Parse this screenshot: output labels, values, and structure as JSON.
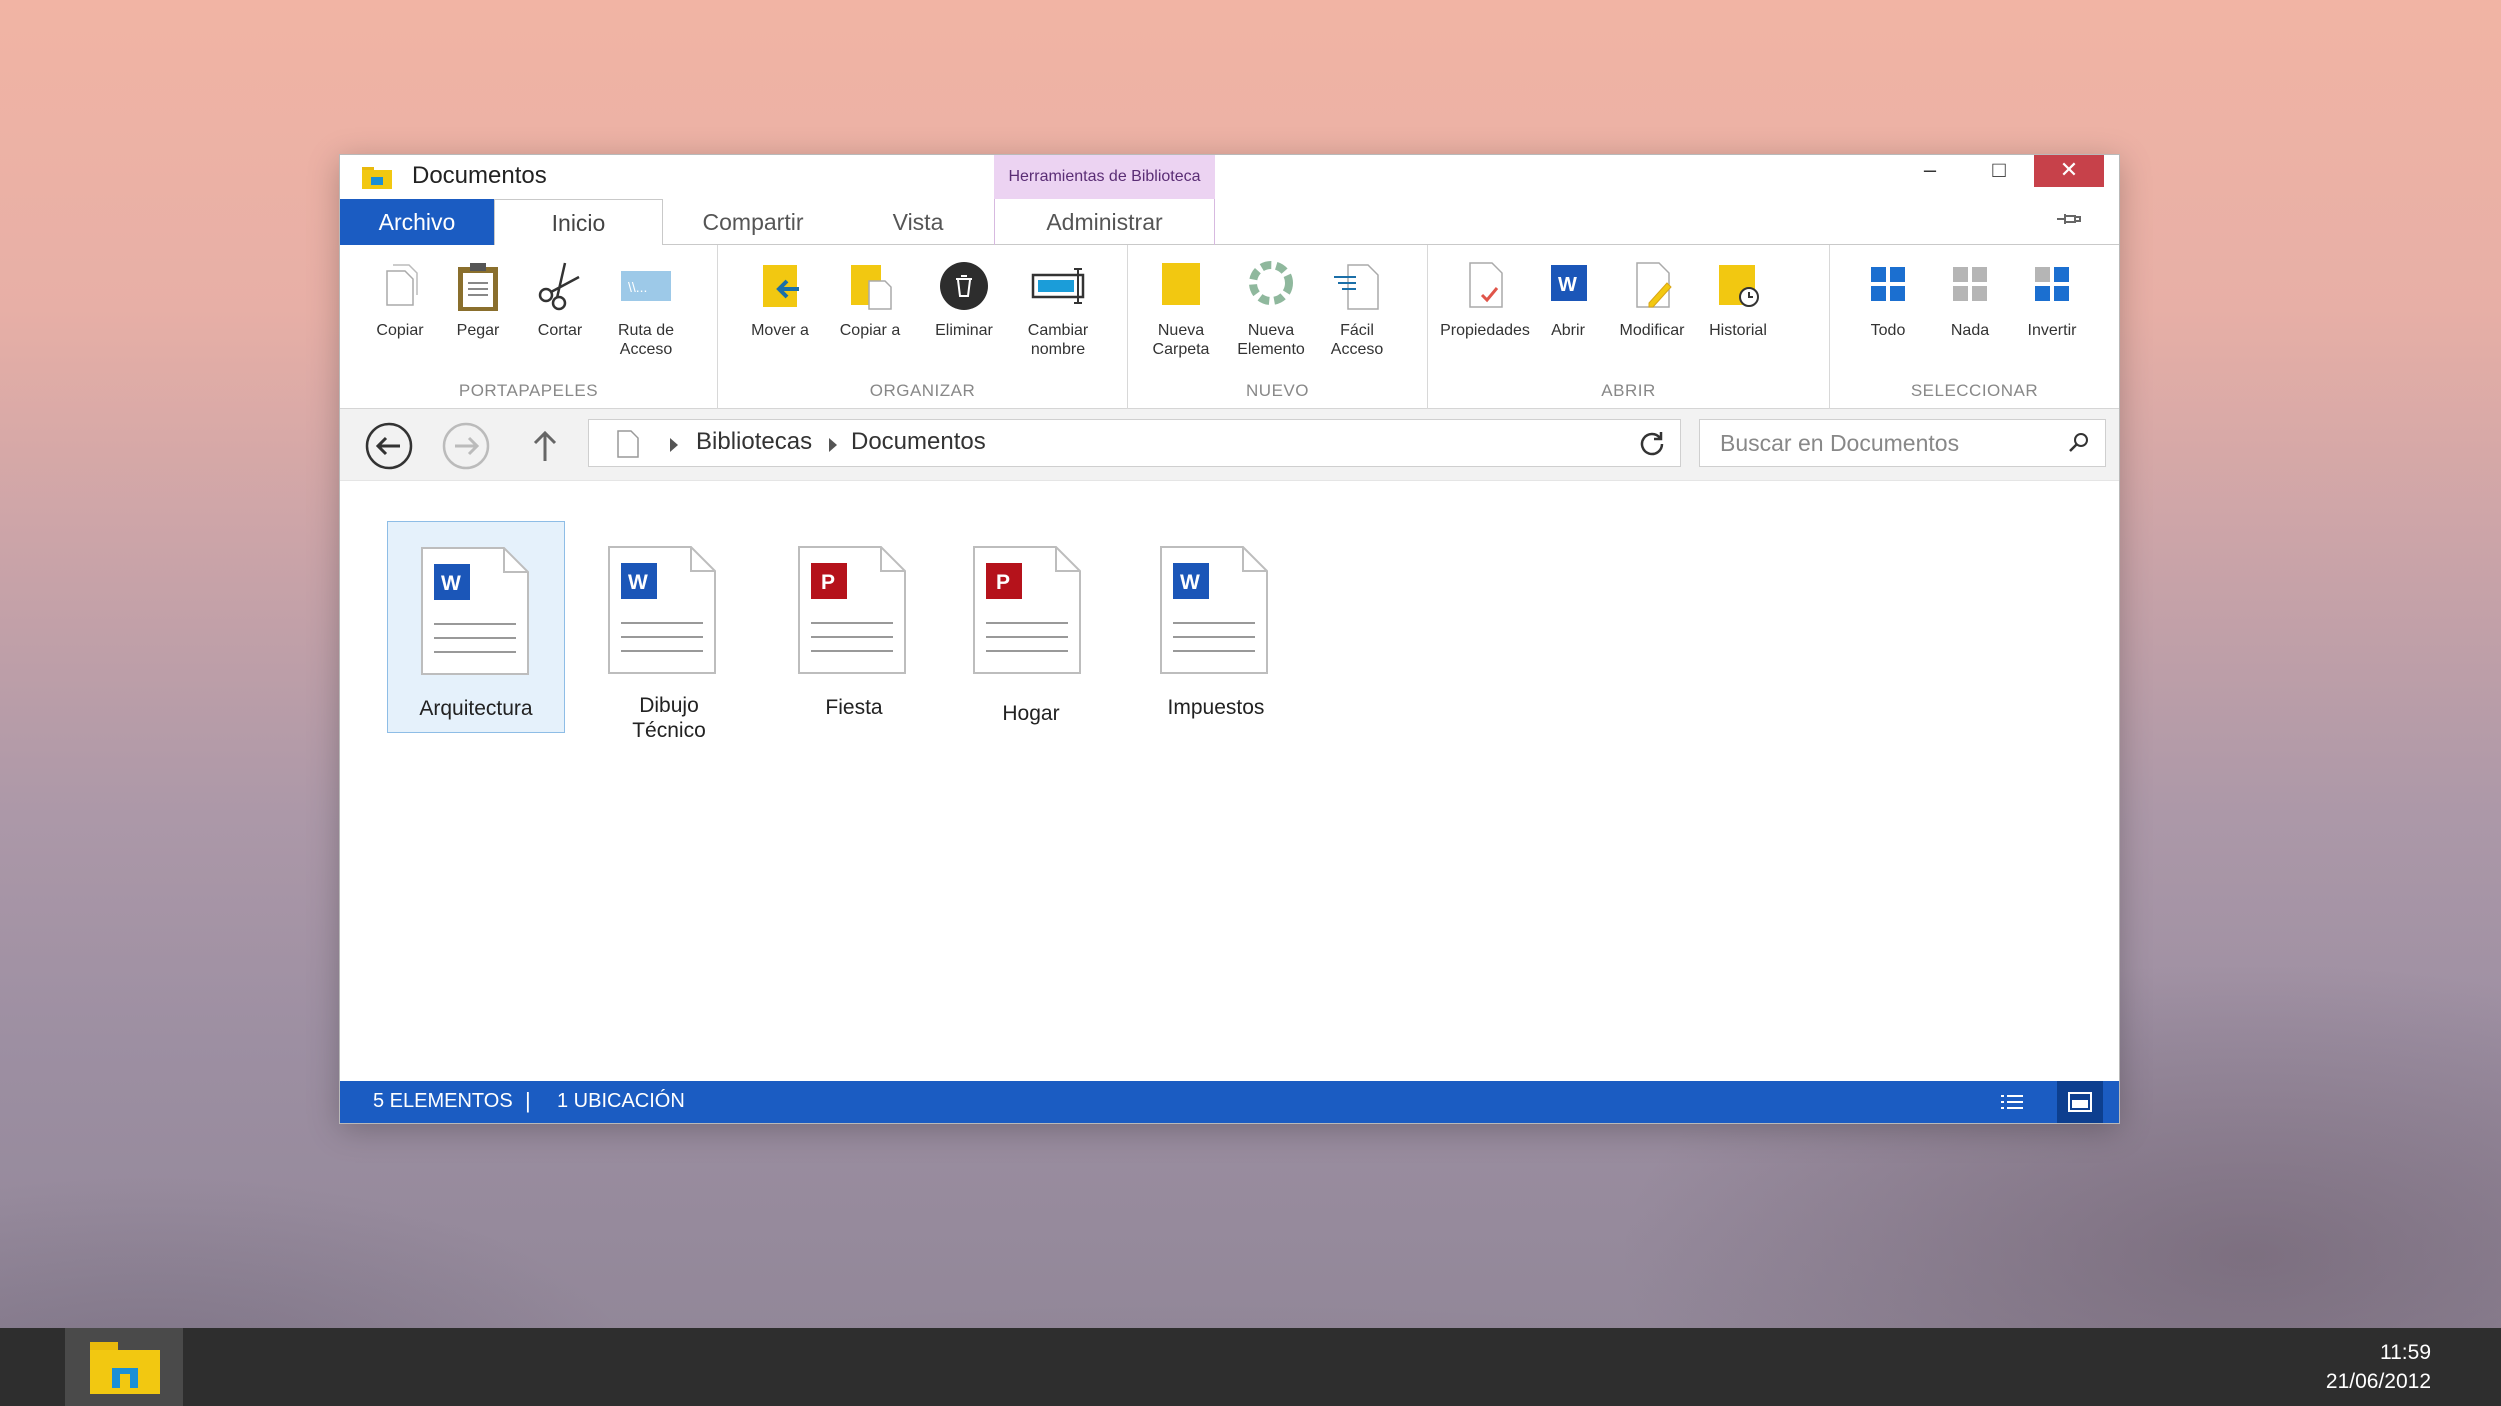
{
  "window": {
    "title": "Documentos"
  },
  "tabs": {
    "file": "Archivo",
    "home": "Inicio",
    "share": "Compartir",
    "view": "Vista",
    "manage": "Administrar",
    "context_header": "Herramientas de Biblioteca"
  },
  "window_buttons": {
    "minimize": "–",
    "maximize": "□",
    "close": "✕"
  },
  "ribbon": {
    "clipboard": {
      "label": "PORTAPAPELES",
      "copy": "Copiar",
      "paste": "Pegar",
      "cut": "Cortar",
      "path1": "Ruta de",
      "path2": "Acceso"
    },
    "organize": {
      "label": "ORGANIZAR",
      "move": "Mover a",
      "copyto": "Copiar a",
      "delete": "Eliminar",
      "rename1": "Cambiar",
      "rename2": "nombre"
    },
    "new": {
      "label": "NUEVO",
      "folder1": "Nueva",
      "folder2": "Carpeta",
      "item1": "Nueva",
      "item2": "Elemento",
      "easy1": "Fácil",
      "easy2": "Acceso"
    },
    "open": {
      "label": "ABRIR",
      "props": "Propiedades",
      "open": "Abrir",
      "edit": "Modificar",
      "history": "Historial"
    },
    "select": {
      "label": "SELECCIONAR",
      "all": "Todo",
      "none": "Nada",
      "invert": "Invertir"
    }
  },
  "address": {
    "crumb1": "Bibliotecas",
    "crumb2": "Documentos"
  },
  "search": {
    "placeholder": "Buscar en Documentos"
  },
  "files": [
    {
      "name": "Arquitectura",
      "type": "W"
    },
    {
      "name1": "Dibujo",
      "name2": "Técnico",
      "type": "W"
    },
    {
      "name": "Fiesta",
      "type": "P"
    },
    {
      "name": "Hogar",
      "type": "P"
    },
    {
      "name": "Impuestos",
      "type": "W"
    }
  ],
  "status": {
    "count": "5 ELEMENTOS",
    "separator": "|",
    "location": "1 UBICACIÓN"
  },
  "clock": {
    "time": "11:59",
    "date": "21/06/2012"
  },
  "colors": {
    "accent": "#1b5cc2",
    "word": "#1b56b8",
    "powerpoint": "#b5121b",
    "folder": "#f2c811",
    "close": "#c7414a"
  }
}
